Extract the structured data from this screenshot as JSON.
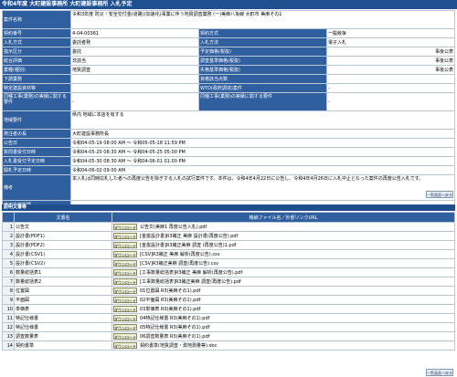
{
  "page_title": "令和4年度 大町建設事務所 大町建設事務所 入札予定",
  "top_button": "一覧画面へ戻る",
  "info_rows": [
    {
      "label": "案件名称",
      "value": "令和3年度 防災・安全交付金(道路)(加速化)事業に伴う地質調査業務 (一)美麻八坂線 大町市 美麻その1"
    },
    {
      "label": "契約番号",
      "value": "4-04-00361",
      "label2": "契約方式",
      "value2": "一般競争"
    },
    {
      "label": "入札方式",
      "value": "委託者発",
      "label2": "入札方法",
      "value2": "電子入札"
    },
    {
      "label": "指示区分",
      "value": "委託",
      "label2": "予定価格(税抜)",
      "value2": "事後公表"
    },
    {
      "label": "総合評価",
      "value": "非該当",
      "label2": "調査基準価格(税抜)",
      "value2": "事後公表"
    },
    {
      "label": "業種(種別)",
      "value": "地質調査",
      "label2": "失格基準価格(税抜)",
      "value2": "事後公表"
    },
    {
      "label": "下請業務",
      "value": "",
      "label2": "資格該当点数",
      "value2": ""
    },
    {
      "label": "特定建設資材等",
      "value": "",
      "label2": "WTO(政府調達)案件",
      "value2": "-"
    },
    {
      "label": "同種工事(業務)の実績に関する要件",
      "value": "-",
      "label2": "同種工事(業務)の実績に関する要件",
      "value2": "-"
    },
    {
      "label": "地域要件",
      "value": "県内 地域に本店を有する"
    },
    {
      "label": "発注者の長",
      "value": "大町建設事務所長"
    },
    {
      "label": "公告日",
      "value": "令和04-05-19 08:00 AM 〜 令和05-05-18 11:59 PM"
    },
    {
      "label": "質問書受付日時",
      "value": "令和04-05-20 08:30 AM 〜 令和04-05-25 05:00 PM"
    },
    {
      "label": "入札書受付予定日時",
      "value": "令和04-05-30 08:30 AM 〜 令和04-06-01 01:00 PM"
    },
    {
      "label": "開札予定日時",
      "value": "令和04-06-02 09:00 AM"
    },
    {
      "label": "備考",
      "value": "本入札は同時応札した者への再度公告を除ぎする入札の試行案件です。本件は、令和4年4月22日に公告し、令和4年4月26日に入札中止となった案件の再度公告入札です。"
    },
    {
      "label": "修正内容履歴",
      "value": ""
    }
  ],
  "docs_section_title": "説明文書等",
  "docs_header": {
    "name": "文書名",
    "file": "格納ファイル名／外部リンクURL"
  },
  "download_label": "ダウンロード",
  "docs": [
    {
      "no": "1",
      "name": "公告文",
      "file": "公告文(美麻1 再度公告入札).pdf"
    },
    {
      "no": "2",
      "name": "設計書(PDF1)",
      "file": "[金抜設計書]R3補正 美麻 設計書(再度公告).pdf"
    },
    {
      "no": "3",
      "name": "設計書(PDF2)",
      "file": "[金抜設計書]R3補正美麻 調査 (再度公告)1.pdf"
    },
    {
      "no": "4",
      "name": "設計書(CSV1)",
      "file": "[CSV]R3補正 美麻 解析(再度公告).csv"
    },
    {
      "no": "5",
      "name": "設計書(CSV2)",
      "file": "[CSV]R3補正美麻 調査(再度公告).csv"
    },
    {
      "no": "6",
      "name": "数量総括表1",
      "file": "[工事数量総括表]R3補正 美麻 解析(再度公告).pdf"
    },
    {
      "no": "7",
      "name": "数量総括表2",
      "file": "[工事数量総括表]R3補正美麻 調査(再度公告).pdf"
    },
    {
      "no": "8",
      "name": "位置図",
      "file": "01位置図 R3(美麻その1).pdf"
    },
    {
      "no": "9",
      "name": "平面図",
      "file": "02平面図 R3(美麻その1).pdf"
    },
    {
      "no": "10",
      "name": "単価表",
      "file": "03単価表 R3(美麻その1).pdf"
    },
    {
      "no": "11",
      "name": "特記仕様書",
      "file": "04特記仕様書 R3(美麻その1).pdf"
    },
    {
      "no": "12",
      "name": "特記仕様書",
      "file": "05特記仕様書 R3(美麻その1).pdf"
    },
    {
      "no": "13",
      "name": "調査数量表",
      "file": "06調査数量表 R3(美麻その1).pdf"
    },
    {
      "no": "14",
      "name": "契約書準",
      "file": "契約書準(地質調査・測地測量等).doc"
    }
  ]
}
